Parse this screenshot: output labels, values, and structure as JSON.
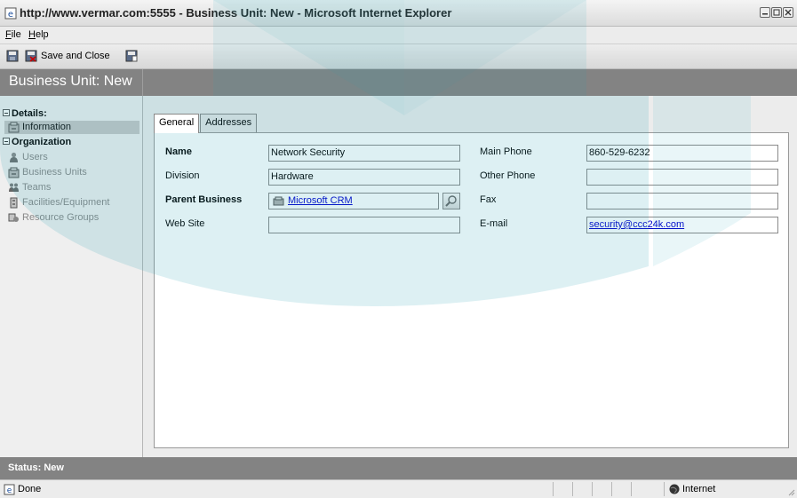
{
  "window": {
    "title": "http://www.vermar.com:5555 - Business Unit: New - Microsoft Internet Explorer"
  },
  "menu": [
    {
      "label": "File",
      "accel": "F",
      "rest": "ile"
    },
    {
      "label": "Help",
      "accel": "H",
      "rest": "elp"
    }
  ],
  "toolbar": {
    "save_close_label": "Save and Close"
  },
  "page": {
    "title": "Business Unit: New"
  },
  "nav": {
    "details_header": "Details:",
    "details_items": [
      {
        "label": "Information",
        "icon": "cabinet-icon",
        "active": true
      }
    ],
    "organization_header": "Organization",
    "organization_items": [
      {
        "label": "Users",
        "icon": "user-icon"
      },
      {
        "label": "Business Units",
        "icon": "cabinet-icon"
      },
      {
        "label": "Teams",
        "icon": "team-icon"
      },
      {
        "label": "Facilities/Equipment",
        "icon": "facility-icon"
      },
      {
        "label": "Resource Groups",
        "icon": "resource-group-icon"
      }
    ]
  },
  "tabs": [
    {
      "label": "General",
      "active": true
    },
    {
      "label": "Addresses",
      "active": false
    }
  ],
  "form": {
    "name": {
      "label": "Name",
      "value": "Network Security"
    },
    "division": {
      "label": "Division",
      "value": "Hardware"
    },
    "parent_business": {
      "label": "Parent Business",
      "value": "Microsoft CRM"
    },
    "web_site": {
      "label": "Web Site",
      "value": ""
    },
    "main_phone": {
      "label": "Main Phone",
      "value": "860-529-6232"
    },
    "other_phone": {
      "label": "Other Phone",
      "value": ""
    },
    "fax": {
      "label": "Fax",
      "value": ""
    },
    "email": {
      "label": "E-mail",
      "value": "security@ccc24k.com"
    }
  },
  "status": {
    "text": "Status: New"
  },
  "browser_status": {
    "text": "Done",
    "zone": "Internet"
  },
  "colors": {
    "header_gray": "#838383",
    "link_blue": "#0000cc",
    "watermark_teal": "#29a3b6"
  }
}
